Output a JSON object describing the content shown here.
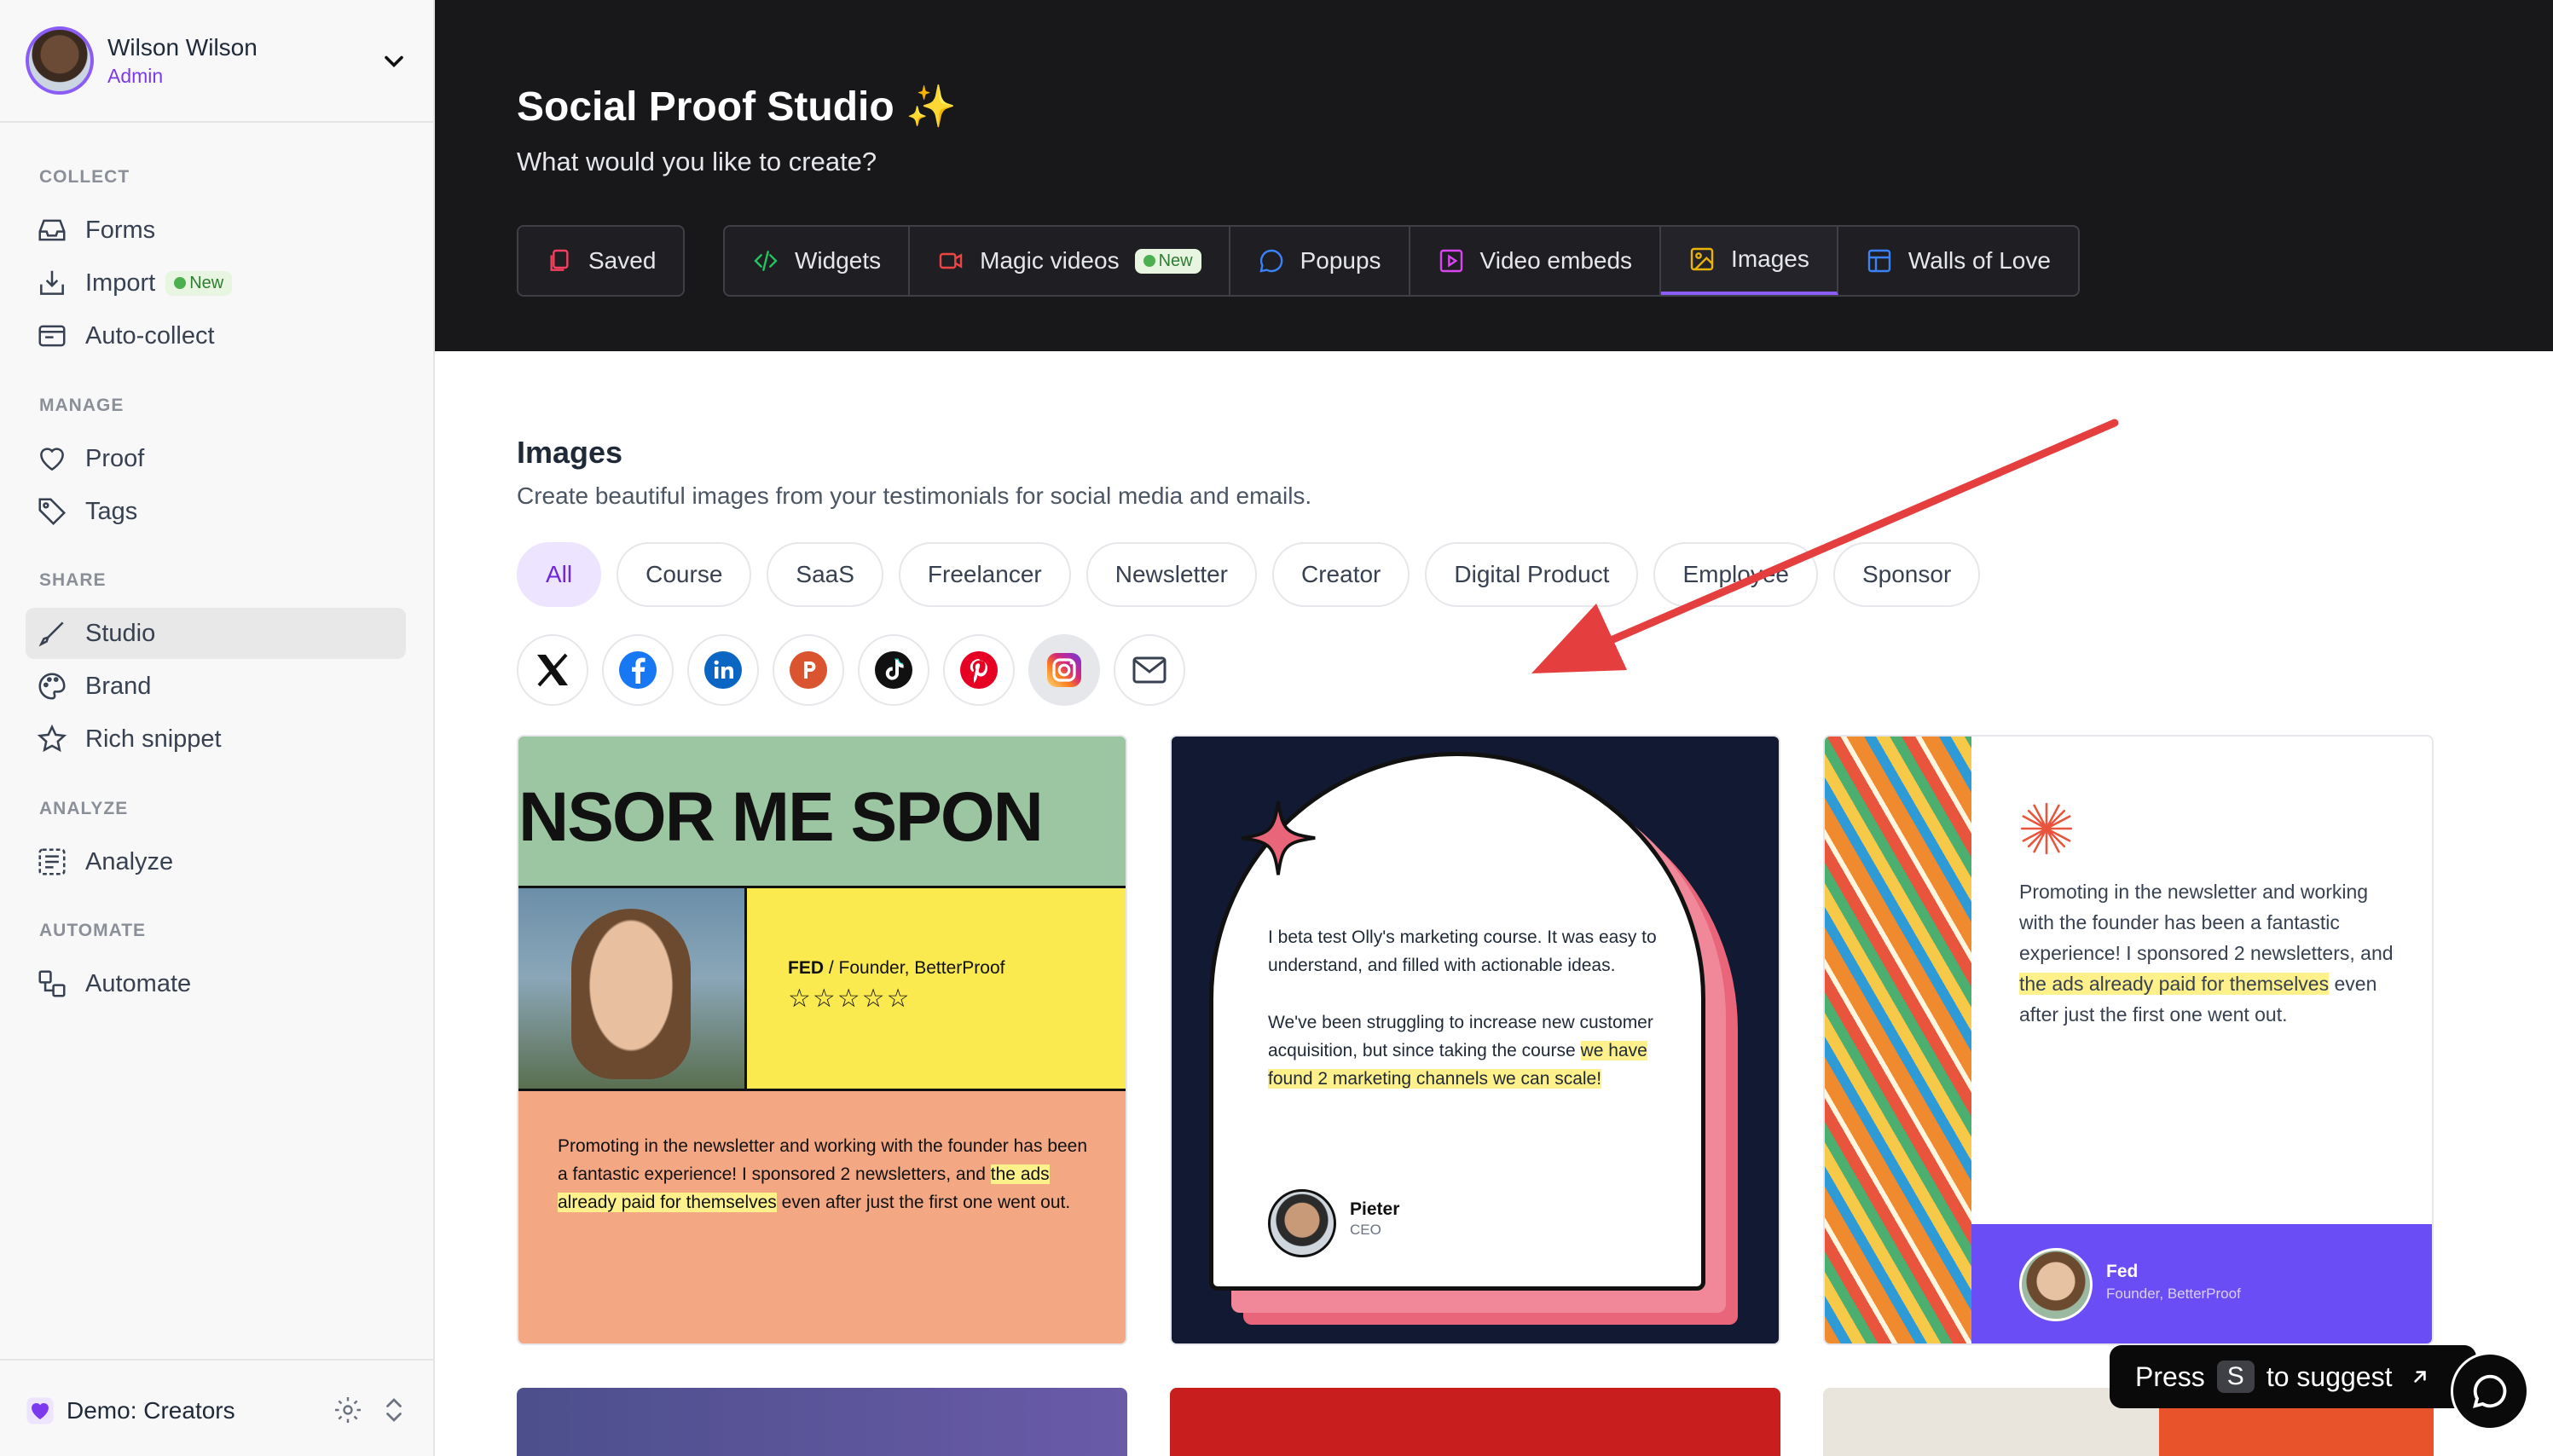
{
  "user": {
    "name": "Wilson Wilson",
    "role": "Admin"
  },
  "sidebar": {
    "sections": [
      {
        "label": "COLLECT",
        "items": [
          {
            "label": "Forms",
            "icon": "inbox-icon"
          },
          {
            "label": "Import",
            "icon": "import-icon",
            "badge": "New"
          },
          {
            "label": "Auto-collect",
            "icon": "auto-collect-icon"
          }
        ]
      },
      {
        "label": "MANAGE",
        "items": [
          {
            "label": "Proof",
            "icon": "heart-icon"
          },
          {
            "label": "Tags",
            "icon": "tag-icon"
          }
        ]
      },
      {
        "label": "SHARE",
        "items": [
          {
            "label": "Studio",
            "icon": "brush-icon",
            "active": true
          },
          {
            "label": "Brand",
            "icon": "palette-icon"
          },
          {
            "label": "Rich snippet",
            "icon": "star-icon"
          }
        ]
      },
      {
        "label": "ANALYZE",
        "items": [
          {
            "label": "Analyze",
            "icon": "analyze-icon"
          }
        ]
      },
      {
        "label": "AUTOMATE",
        "items": [
          {
            "label": "Automate",
            "icon": "automate-icon"
          }
        ]
      }
    ],
    "workspace": "Demo: Creators"
  },
  "hero": {
    "title": "Social Proof Studio",
    "sparkle": "✨",
    "subtitle": "What would you like to create?",
    "tabs": [
      {
        "label": "Saved",
        "icon": "saved-icon"
      },
      {
        "label": "Widgets",
        "icon": "code-icon"
      },
      {
        "label": "Magic videos",
        "icon": "video-icon",
        "badge": "New"
      },
      {
        "label": "Popups",
        "icon": "chat-icon"
      },
      {
        "label": "Video embeds",
        "icon": "play-icon"
      },
      {
        "label": "Images",
        "icon": "image-icon",
        "active": true
      },
      {
        "label": "Walls of Love",
        "icon": "layout-icon"
      }
    ]
  },
  "images_section": {
    "title": "Images",
    "description": "Create beautiful images from your testimonials for social media and emails.",
    "categories": [
      "All",
      "Course",
      "SaaS",
      "Freelancer",
      "Newsletter",
      "Creator",
      "Digital Product",
      "Employee",
      "Sponsor"
    ],
    "active_category": "All",
    "socials": [
      "x-icon",
      "facebook-icon",
      "linkedin-icon",
      "producthunt-icon",
      "tiktok-icon",
      "pinterest-icon",
      "instagram-icon",
      "email-icon"
    ],
    "active_social": "instagram-icon"
  },
  "cards": [
    {
      "ticker": "NSOR ME  SPON",
      "author_name": "FED",
      "author_sep": " / ",
      "author_title": "Founder, BetterProof",
      "stars": "☆☆☆☆☆",
      "text_a": "Promoting in the newsletter and working with the founder has been a fantastic experience! I sponsored 2 newsletters, and ",
      "text_hl": "the ads already paid for themselves",
      "text_b": " even after just the first one went out."
    },
    {
      "p1": "I beta test Olly's marketing course. It was easy to understand, and filled with actionable ideas.",
      "p2_a": "We've been struggling to increase new customer acquisition, but since taking the course ",
      "p2_hl": "we have found 2 marketing channels we can scale!",
      "name": "Pieter",
      "role": "CEO"
    },
    {
      "text_a": "Promoting in the newsletter and working with the founder has been a fantastic experience! I sponsored 2 newsletters, and ",
      "text_hl": "the ads already paid for themselves",
      "text_b": " even after just the first one went out.",
      "name": "Fed",
      "role": "Founder, BetterProof"
    }
  ],
  "suggest": {
    "press": "Press",
    "key": "S",
    "rest": "to suggest"
  },
  "colors": {
    "accent": "#8b5cf6",
    "arrow": "#e53e3e",
    "hero_bg": "#18181b"
  }
}
